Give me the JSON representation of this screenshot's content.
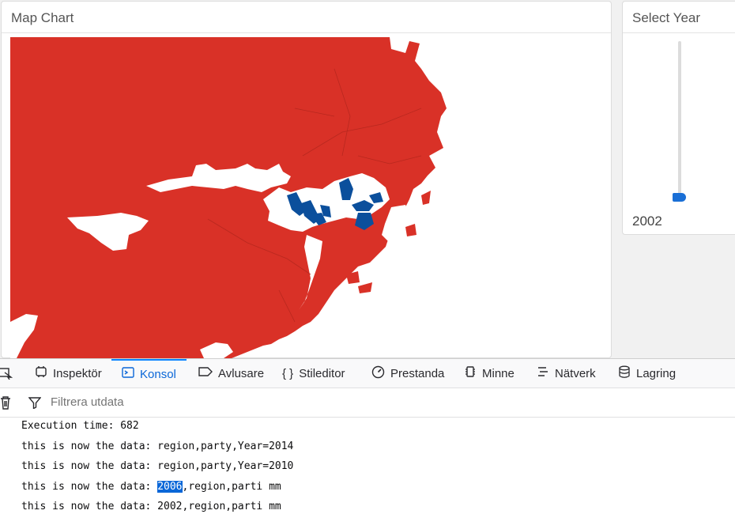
{
  "map_panel": {
    "title": "Map Chart"
  },
  "year_panel": {
    "title": "Select Year",
    "selected_year": "2002"
  },
  "colors": {
    "red_party": "#d93127",
    "blue_party": "#0b4f9c",
    "accent": "#0a84ff"
  },
  "devtools": {
    "tabs": [
      {
        "label": "Inspektör",
        "icon": "inspector-icon"
      },
      {
        "label": "Konsol",
        "icon": "console-icon",
        "active": true
      },
      {
        "label": "Avlusare",
        "icon": "debugger-icon"
      },
      {
        "label": "Stileditor",
        "icon": "style-editor-icon"
      },
      {
        "label": "Prestanda",
        "icon": "performance-icon"
      },
      {
        "label": "Minne",
        "icon": "memory-icon"
      },
      {
        "label": "Nätverk",
        "icon": "network-icon"
      },
      {
        "label": "Lagring",
        "icon": "storage-icon"
      }
    ],
    "filter_placeholder": "Filtrera utdata",
    "console_lines": [
      "Execution time: 682",
      "this is now the data: region,party,Year=2014",
      "this is now the data: region,party,Year=2010",
      {
        "selected": "2006",
        "rest": ",region,parti mm"
      },
      "this is now the data: 2002,region,parti mm"
    ],
    "console_line4_prefix": "this is now the data: "
  }
}
